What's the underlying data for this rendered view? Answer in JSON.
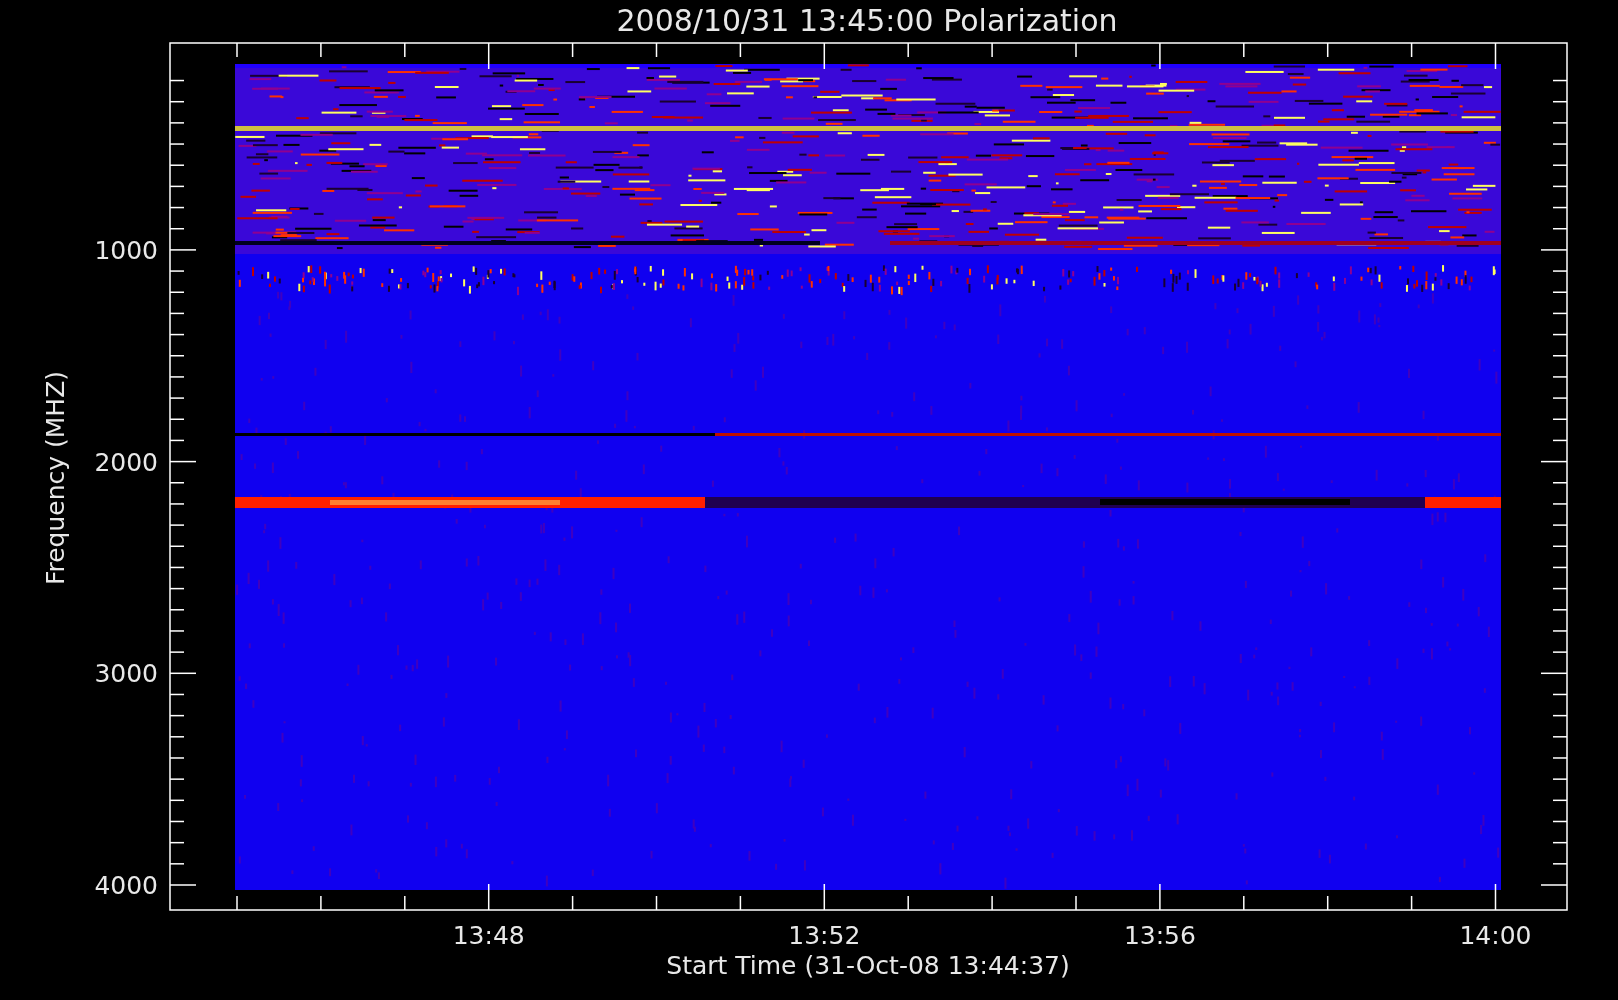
{
  "title": "2008/10/31 13:45:00 Polarization",
  "y_axis": {
    "label": "Frequency (MHZ)",
    "ticks": [
      "1000",
      "2000",
      "3000",
      "4000"
    ]
  },
  "x_axis": {
    "label": "Start Time (31-Oct-08 13:44:37)",
    "ticks": [
      "13:48",
      "13:52",
      "13:56",
      "14:00"
    ]
  }
}
